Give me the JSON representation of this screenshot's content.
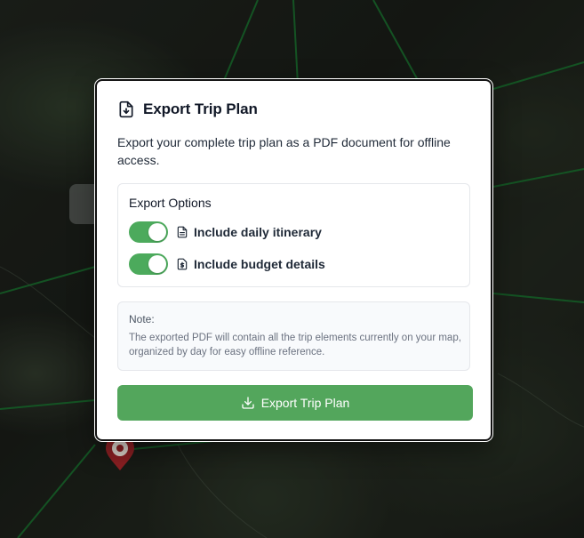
{
  "dialog": {
    "title": "Export Trip Plan",
    "title_icon": "file-download-icon",
    "description": "Export your complete trip plan as a PDF document for offline access.",
    "options_title": "Export Options",
    "options": [
      {
        "label": "Include daily itinerary",
        "icon": "document-icon",
        "enabled": true
      },
      {
        "label": "Include budget details",
        "icon": "dollar-icon",
        "enabled": true
      }
    ],
    "note_title": "Note:",
    "note_text": "The exported PDF will contain all the trip elements currently on your map, organized by day for easy offline reference.",
    "export_button_label": "Export Trip Plan",
    "export_button_icon": "download-icon"
  },
  "colors": {
    "accent": "#53a65c",
    "toggle_on": "#4caa5c",
    "route_line": "#1f8a3a"
  }
}
